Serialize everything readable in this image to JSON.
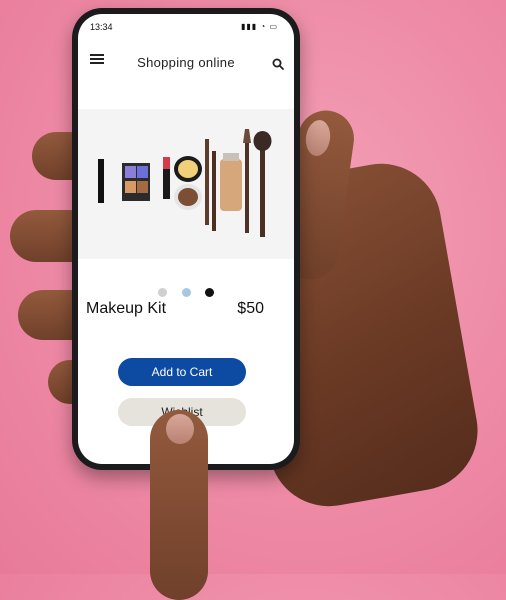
{
  "status": {
    "time": "13:34",
    "icons": "▮▮▮ ◔ ▭"
  },
  "header": {
    "title": "Shopping online"
  },
  "product": {
    "name": "Makeup Kit",
    "price": "$50"
  },
  "carousel": {
    "active_index": 2,
    "count": 3
  },
  "buttons": {
    "add_to_cart": "Add to Cart",
    "wishlist": "Wishlist"
  },
  "colors": {
    "background": "#ee8aa6",
    "primary": "#0d4aa1",
    "secondary": "#e5e3dc"
  },
  "icons": {
    "menu": "menu-icon",
    "search": "search-icon"
  }
}
